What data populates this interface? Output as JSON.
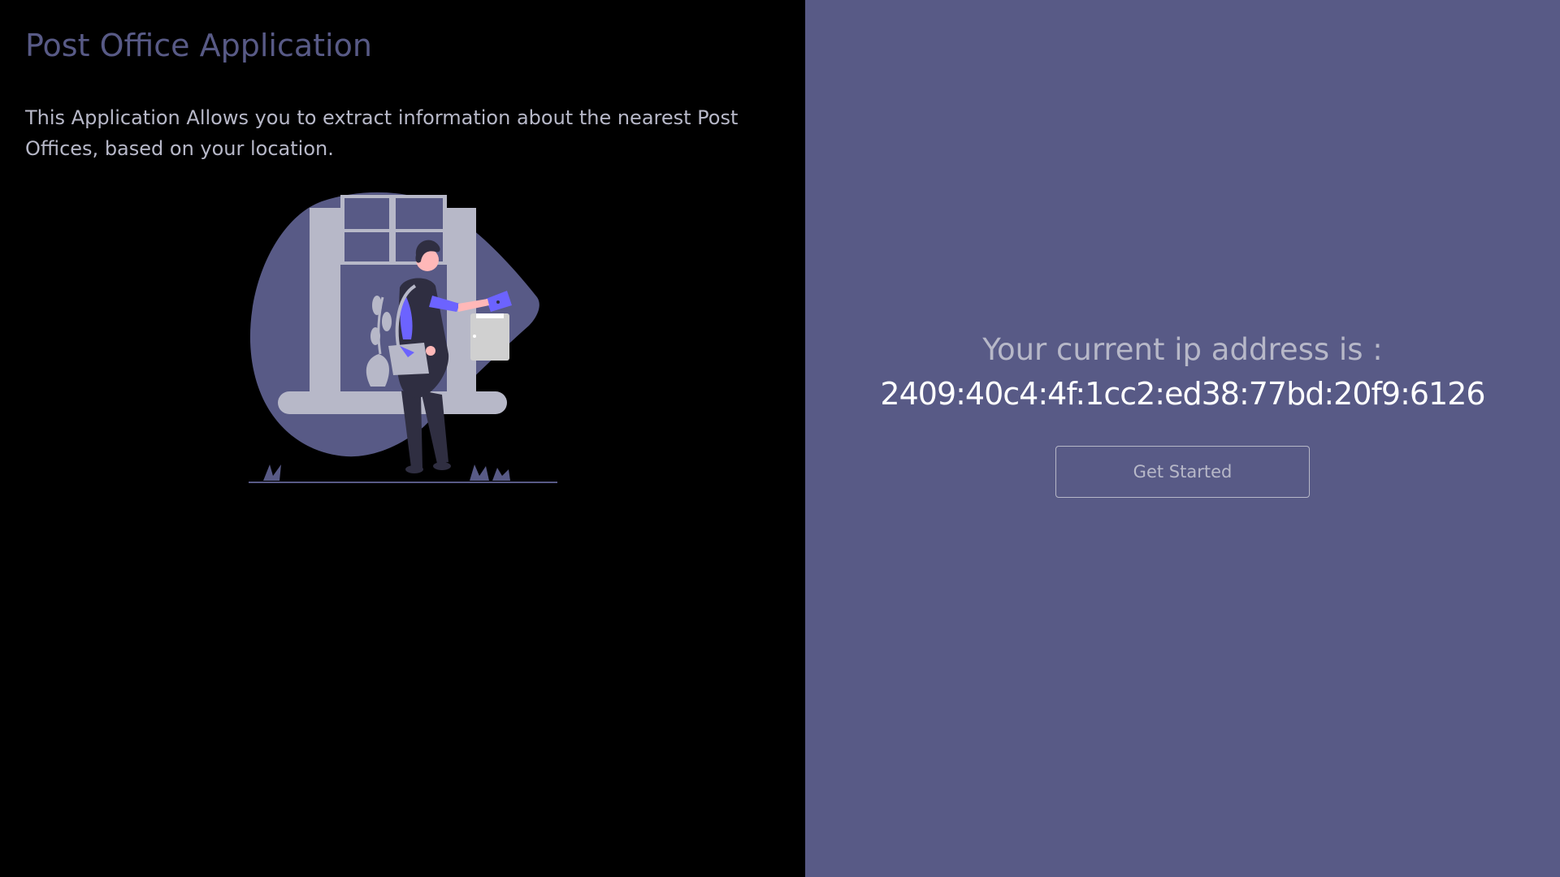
{
  "left": {
    "title": "Post Office Application",
    "description": "This Application Allows you to extract information about the nearest Post Offices, based on your location."
  },
  "right": {
    "ip_label": "Your current ip address is :",
    "ip_value": "2409:40c4:4f:1cc2:ed38:77bd:20f9:6126",
    "button_label": "Get Started"
  },
  "colors": {
    "accent": "#585a86",
    "left_background": "#000000",
    "muted_text": "#b7b8c8",
    "highlight": "#6c63ff"
  },
  "illustration": {
    "icon": "mail-delivery-illustration"
  }
}
